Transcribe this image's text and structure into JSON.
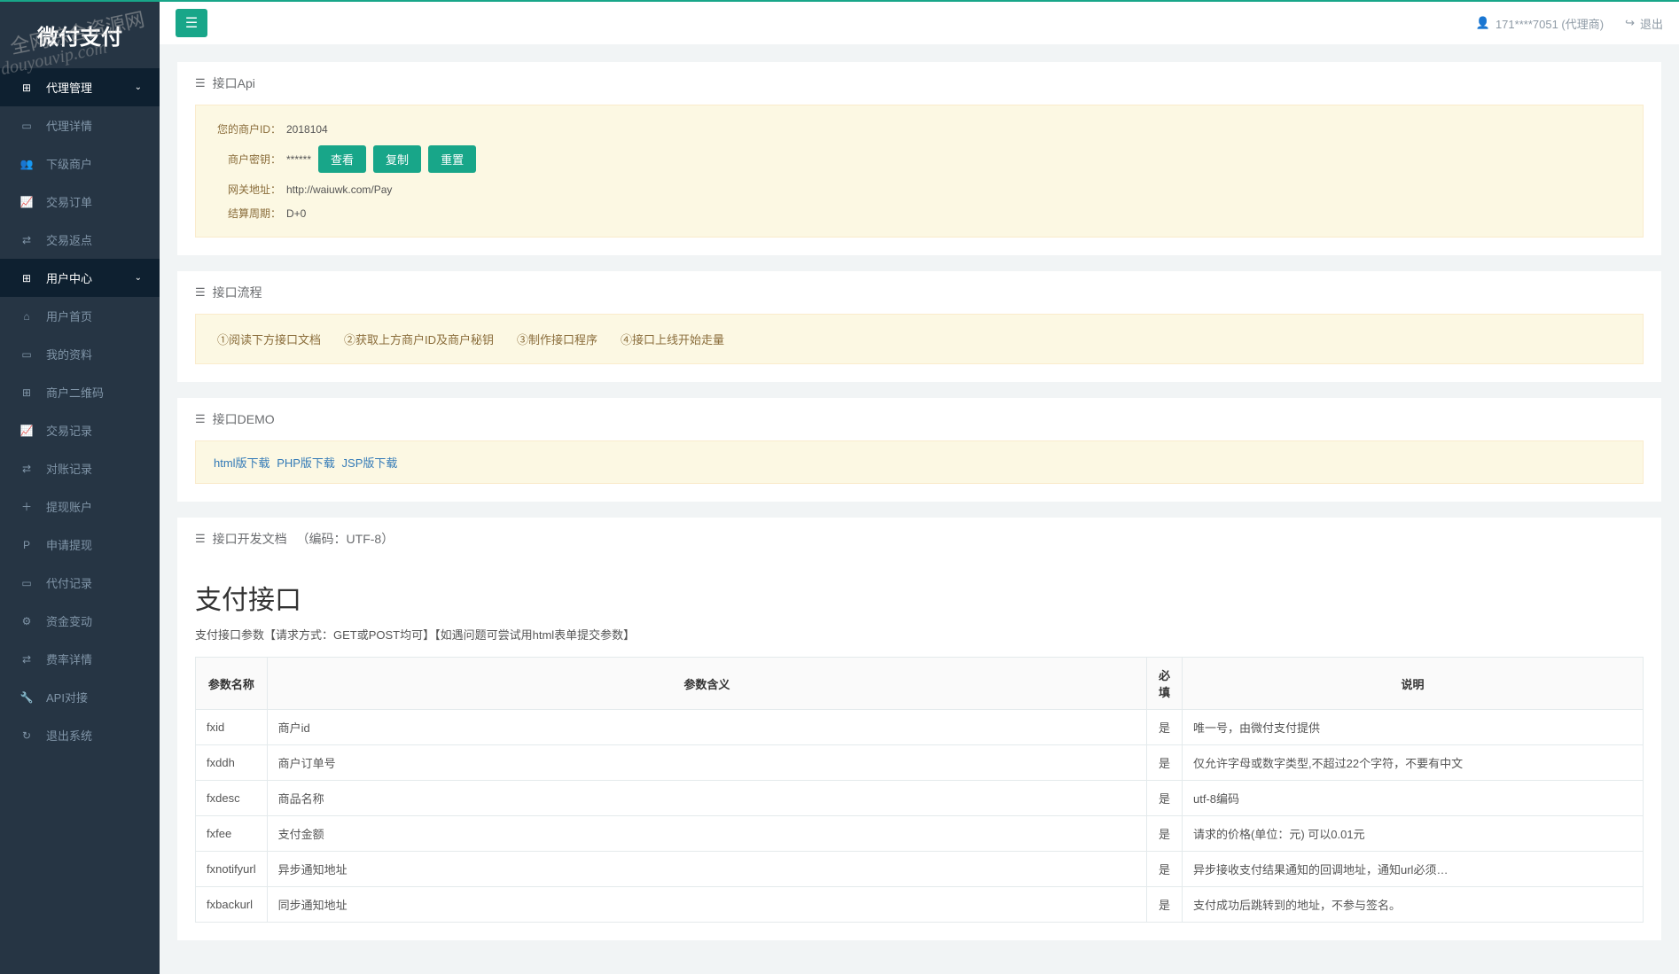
{
  "brand": "微付支付",
  "watermark1": "全网综合资源网",
  "watermark2": "douyouvip.com",
  "topbar": {
    "user": "171****7051 (代理商)",
    "logout": "退出"
  },
  "sidebar": {
    "agent_mgmt": "代理管理",
    "items1": [
      {
        "icon": "▭",
        "label": "代理详情"
      },
      {
        "icon": "👥",
        "label": "下级商户"
      },
      {
        "icon": "📈",
        "label": "交易订单"
      },
      {
        "icon": "⇄",
        "label": "交易返点"
      }
    ],
    "user_center": "用户中心",
    "items2": [
      {
        "icon": "⌂",
        "label": "用户首页"
      },
      {
        "icon": "▭",
        "label": "我的资料"
      },
      {
        "icon": "⊞",
        "label": "商户二维码"
      },
      {
        "icon": "📈",
        "label": "交易记录"
      },
      {
        "icon": "⇄",
        "label": "对账记录"
      },
      {
        "icon": "＋",
        "label": "提现账户"
      },
      {
        "icon": "P",
        "label": "申请提现"
      },
      {
        "icon": "▭",
        "label": "代付记录"
      },
      {
        "icon": "⚙",
        "label": "资金变动"
      },
      {
        "icon": "⇄",
        "label": "费率详情"
      },
      {
        "icon": "🔧",
        "label": "API对接"
      },
      {
        "icon": "↻",
        "label": "退出系统"
      }
    ]
  },
  "api_panel": {
    "title": "接口Api",
    "merchant_id_label": "您的商户ID：",
    "merchant_id": "2018104",
    "secret_label": "商户密钥：",
    "secret_mask": "******",
    "btn_view": "查看",
    "btn_copy": "复制",
    "btn_reset": "重置",
    "gateway_label": "网关地址：",
    "gateway": "http://waiuwk.com/Pay",
    "settle_label": "结算周期：",
    "settle": "D+0"
  },
  "flow_panel": {
    "title": "接口流程",
    "text": "①阅读下方接口文档　　②获取上方商户ID及商户秘钥　　③制作接口程序　　④接口上线开始走量"
  },
  "demo_panel": {
    "title": "接口DEMO",
    "links": [
      "html版下载",
      "PHP版下载",
      "JSP版下载"
    ]
  },
  "doc_panel": {
    "title": "接口开发文档 　（编码：UTF-8）",
    "heading": "支付接口",
    "sub": "支付接口参数【请求方式：GET或POST均可】【如遇问题可尝试用html表单提交参数】",
    "headers": {
      "name": "参数名称",
      "meaning": "参数含义",
      "required": "必填",
      "desc": "说明"
    },
    "rows": [
      {
        "name": "fxid",
        "meaning": "商户id",
        "req": "是",
        "desc": "唯一号，由微付支付提供"
      },
      {
        "name": "fxddh",
        "meaning": "商户订单号",
        "req": "是",
        "desc": "仅允许字母或数字类型,不超过22个字符，不要有中文"
      },
      {
        "name": "fxdesc",
        "meaning": "商品名称",
        "req": "是",
        "desc": "utf-8编码"
      },
      {
        "name": "fxfee",
        "meaning": "支付金额",
        "req": "是",
        "desc": "请求的价格(单位：元) 可以0.01元"
      },
      {
        "name": "fxnotifyurl",
        "meaning": "异步通知地址",
        "req": "是",
        "desc": "异步接收支付结果通知的回调地址，通知url必须…"
      },
      {
        "name": "fxbackurl",
        "meaning": "同步通知地址",
        "req": "是",
        "desc": "支付成功后跳转到的地址，不参与签名。"
      }
    ]
  }
}
